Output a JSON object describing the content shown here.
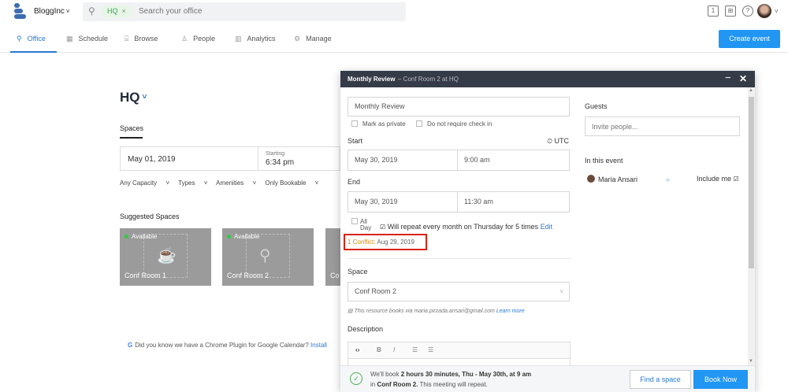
{
  "header": {
    "org_name": "BloggInc",
    "search_chip": "HQ",
    "search_placeholder": "Search your office",
    "icons": [
      "calendar-icon",
      "gift-icon",
      "help-icon"
    ]
  },
  "nav": {
    "items": [
      {
        "label": "Office",
        "icon": "search"
      },
      {
        "label": "Schedule",
        "icon": "calendar"
      },
      {
        "label": "Browse",
        "icon": "floorplan"
      },
      {
        "label": "People",
        "icon": "person"
      },
      {
        "label": "Analytics",
        "icon": "chart"
      },
      {
        "label": "Manage",
        "icon": "gear"
      }
    ],
    "create_label": "Create event"
  },
  "office": {
    "title": "HQ",
    "tab": "Spaces",
    "date": "May 01, 2019",
    "starting_label": "Starting",
    "starting_time": "6:34 pm",
    "filters": [
      "Any Capacity",
      "Types",
      "Amenities",
      "Only Bookable"
    ],
    "suggested_title": "Suggested Spaces",
    "cards": [
      {
        "status": "Available",
        "name": "Conf Room 1"
      },
      {
        "status": "Available",
        "name": "Conf Room 2"
      },
      {
        "status": "",
        "name": "Co"
      }
    ],
    "tip": "Did you know we have a Chrome Plugin for Google Calendar?",
    "tip_link": "Install"
  },
  "modal": {
    "title": "Monthly Review",
    "subtitle": "– Conf Room 2 at  HQ",
    "event_name": "Monthly Review",
    "mark_private": "Mark as private",
    "no_checkin": "Do not require check in",
    "start_label": "Start",
    "timezone": "UTC",
    "start_date": "May 30, 2019",
    "start_time": "9:00 am",
    "end_label": "End",
    "end_date": "May 30, 2019",
    "end_time": "11:30 am",
    "all_day_1": "All",
    "all_day_2": "Day",
    "repeat": "Will repeat every month on Thursday for 5 times",
    "repeat_edit": "Edit",
    "conflict_label": "1 Conflict:",
    "conflict_date": "Aug 29, 2019",
    "space_label": "Space",
    "space_value": "Conf Room 2",
    "resource_note": "This resource books via maria.pirzada.ansari@gmail.com",
    "learn_more": "Learn more",
    "description_label": "Description",
    "guests_label": "Guests",
    "guests_placeholder": "Invite people...",
    "in_event_label": "In this event",
    "attendee": "Maria Ansari",
    "include_me": "Include me",
    "footer_line1_pre": "We'll book",
    "footer_line1_bold": "2 hours 30 minutes, Thu - May 30th, at 9 am",
    "footer_line2_pre": "in",
    "footer_line2_bold": "Conf Room 2.",
    "footer_line2_post": "This meeting will repeat.",
    "find_space": "Find a space",
    "book_now": "Book Now"
  },
  "colors": {
    "accent": "#2196f3",
    "header_dark": "#363b48",
    "conflict": "#e08a00",
    "available": "#2ecc40"
  }
}
